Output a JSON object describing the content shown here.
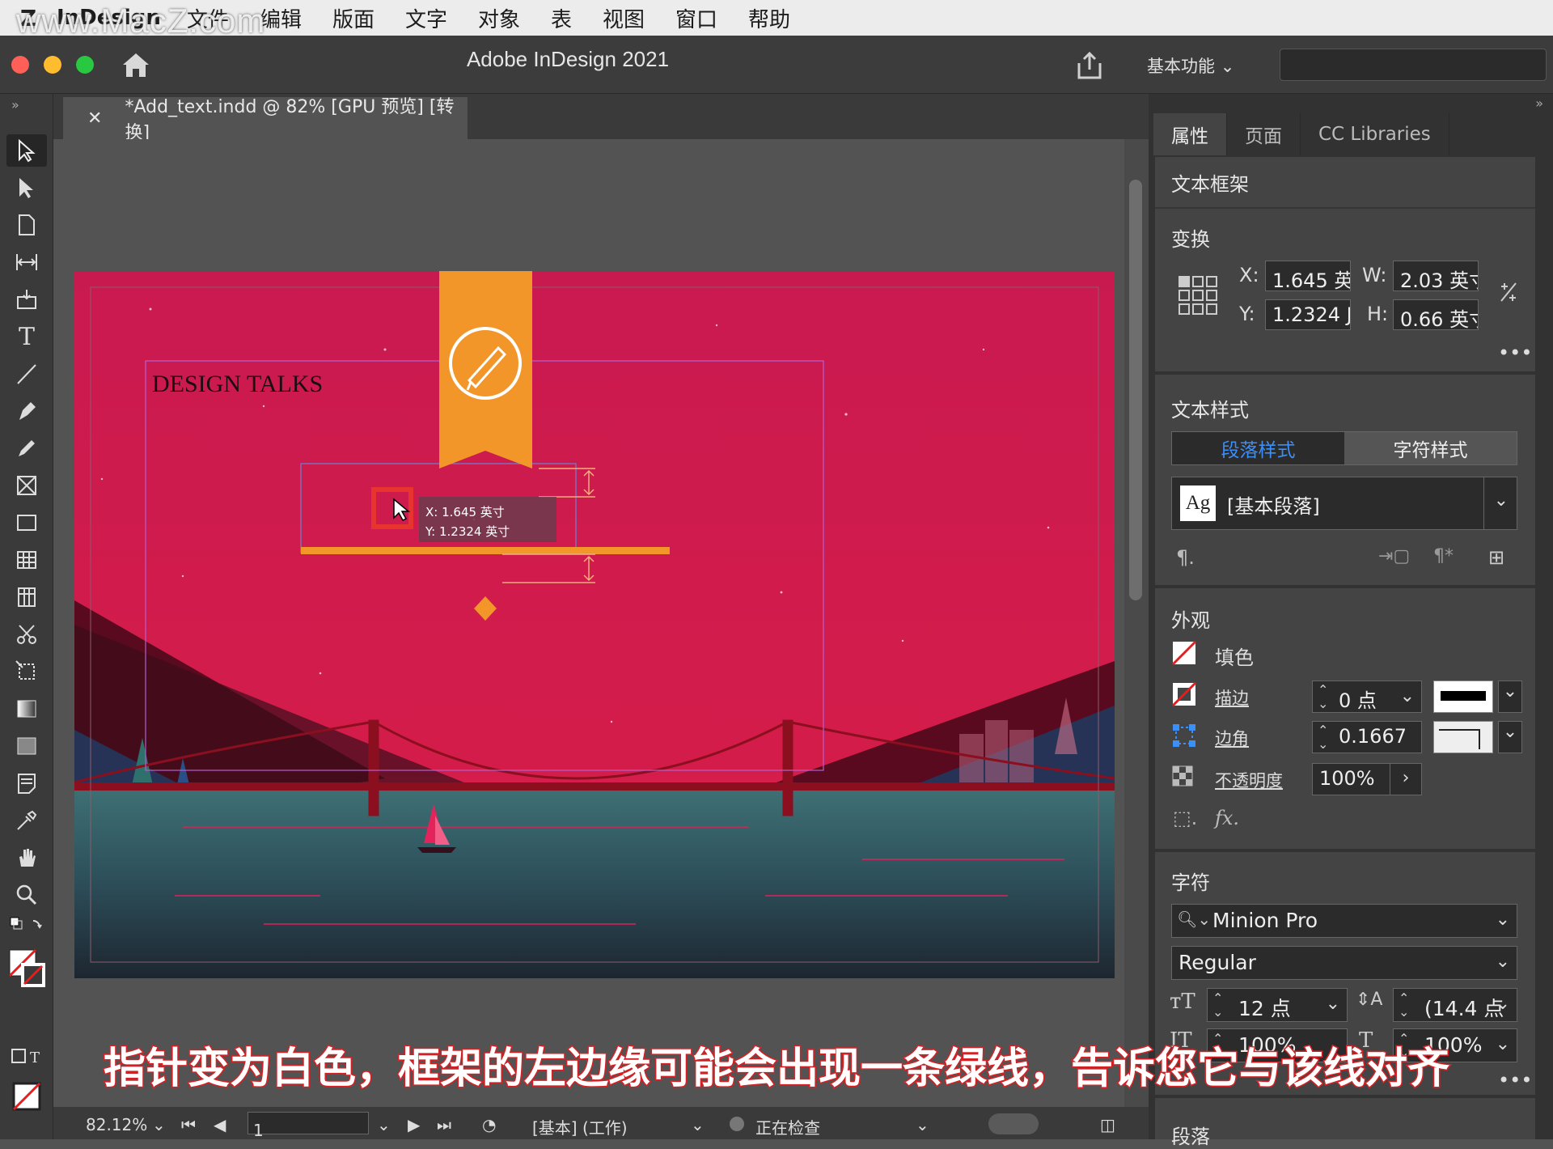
{
  "menubar": {
    "app_name": "InDesign",
    "items": [
      "文件",
      "编辑",
      "版面",
      "文字",
      "对象",
      "表",
      "视图",
      "窗口",
      "帮助"
    ],
    "watermark": "www.MacZ.com"
  },
  "titlebar": {
    "title": "Adobe InDesign 2021",
    "workspace": "基本功能"
  },
  "document_tab": {
    "title": "*Add_text.indd @ 82% [GPU 预览] [转换]"
  },
  "artboard": {
    "headline": "DESIGN TALKS",
    "readout_x": "X: 1.645 英寸",
    "readout_y": "Y: 1.2324 英寸",
    "colors": {
      "sky": "#d0184e",
      "banner": "#f2962a",
      "sea": "#3f6f74"
    }
  },
  "panel": {
    "tabs": [
      "属性",
      "页面",
      "CC Libraries"
    ],
    "section_title": "文本框架",
    "transform": {
      "heading": "变换",
      "x_label": "X:",
      "x_value": "1.645 英",
      "y_label": "Y:",
      "y_value": "1.2324 J",
      "w_label": "W:",
      "w_value": "2.03 英寸",
      "h_label": "H:",
      "h_value": "0.66 英寸"
    },
    "text_style": {
      "heading": "文本样式",
      "tab_paragraph": "段落样式",
      "tab_character": "字符样式",
      "style_value": "[基本段落]",
      "ag_label": "Ag"
    },
    "appearance": {
      "heading": "外观",
      "fill_label": "填色",
      "stroke_label": "描边",
      "stroke_value": "0 点",
      "corner_label": "边角",
      "corner_value": "0.1667",
      "opacity_label": "不透明度",
      "opacity_value": "100%",
      "fx_label": "fx."
    },
    "character": {
      "heading": "字符",
      "font": "Minion Pro",
      "style": "Regular",
      "size": "12 点",
      "leading": "(14.4 点",
      "v_scale": "100%",
      "h_scale": "100%"
    },
    "next_heading": "段落"
  },
  "statusbar": {
    "zoom": "82.12%",
    "page": "1",
    "master": "[基本] (工作)",
    "preflight": "正在检查"
  },
  "subtitle": "指针变为白色，框架的左边缘可能会出现一条绿线，告诉您它与该线对齐"
}
